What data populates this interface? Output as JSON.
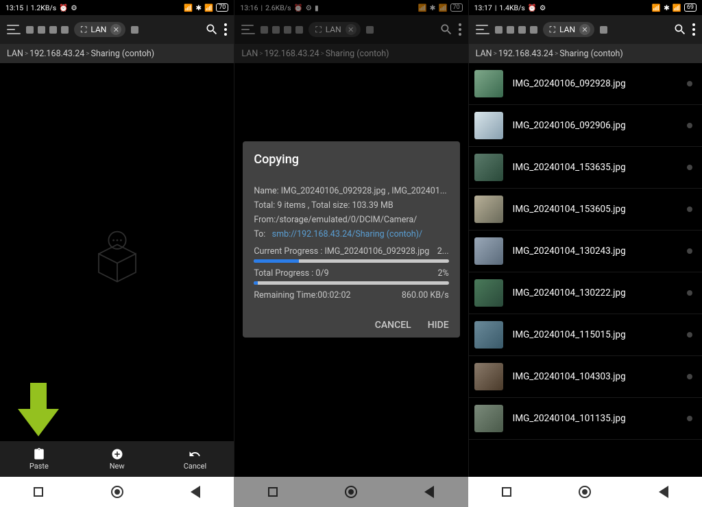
{
  "panes": [
    {
      "status": {
        "time": "13:15",
        "speed": "1.2KB/s",
        "battery": "70"
      },
      "tab": {
        "label": "LAN"
      },
      "breadcrumb": {
        "root": "LAN",
        "ip": "192.168.43.24",
        "folder": "Sharing (contoh)"
      },
      "actions": {
        "paste": "Paste",
        "new": "New",
        "cancel": "Cancel"
      }
    },
    {
      "status": {
        "time": "13:16",
        "speed": "2.6KB/s",
        "battery": "70"
      },
      "tab": {
        "label": "LAN"
      },
      "breadcrumb": {
        "root": "LAN",
        "ip": "192.168.43.24",
        "folder": "Sharing (contoh)"
      },
      "dialog": {
        "title": "Copying",
        "name_label": "Name:",
        "name_value": "IMG_20240106_092928.jpg , IMG_202401...",
        "total_label": "Total:",
        "total_value": "9 items , Total size: 103.39 MB",
        "from_label": "From:",
        "from_value": "/storage/emulated/0/DCIM/Camera/",
        "to_label": "To:",
        "to_value": "smb://192.168.43.24/Sharing (contoh)/",
        "cur_label": "Current Progress :",
        "cur_file": "IMG_20240106_092928.jpg",
        "cur_pct": "2...",
        "cur_bar_pct": 23,
        "tot_label": "Total Progress :",
        "tot_count": "0/9",
        "tot_pct": "2%",
        "tot_bar_pct": 2,
        "remain_label": "Remaining Time:",
        "remain_value": "00:02:02",
        "rate": "860.00 KB/s",
        "cancel": "CANCEL",
        "hide": "HIDE"
      }
    },
    {
      "status": {
        "time": "13:17",
        "speed": "1.4KB/s",
        "battery": "69"
      },
      "tab": {
        "label": "LAN"
      },
      "breadcrumb": {
        "root": "LAN",
        "ip": "192.168.43.24",
        "folder": "Sharing (contoh)"
      },
      "files": [
        {
          "name": "IMG_20240106_092928.jpg"
        },
        {
          "name": "IMG_20240106_092906.jpg"
        },
        {
          "name": "IMG_20240104_153635.jpg"
        },
        {
          "name": "IMG_20240104_153605.jpg"
        },
        {
          "name": "IMG_20240104_130243.jpg"
        },
        {
          "name": "IMG_20240104_130222.jpg"
        },
        {
          "name": "IMG_20240104_115015.jpg"
        },
        {
          "name": "IMG_20240104_104303.jpg"
        },
        {
          "name": "IMG_20240104_101135.jpg"
        }
      ]
    }
  ]
}
